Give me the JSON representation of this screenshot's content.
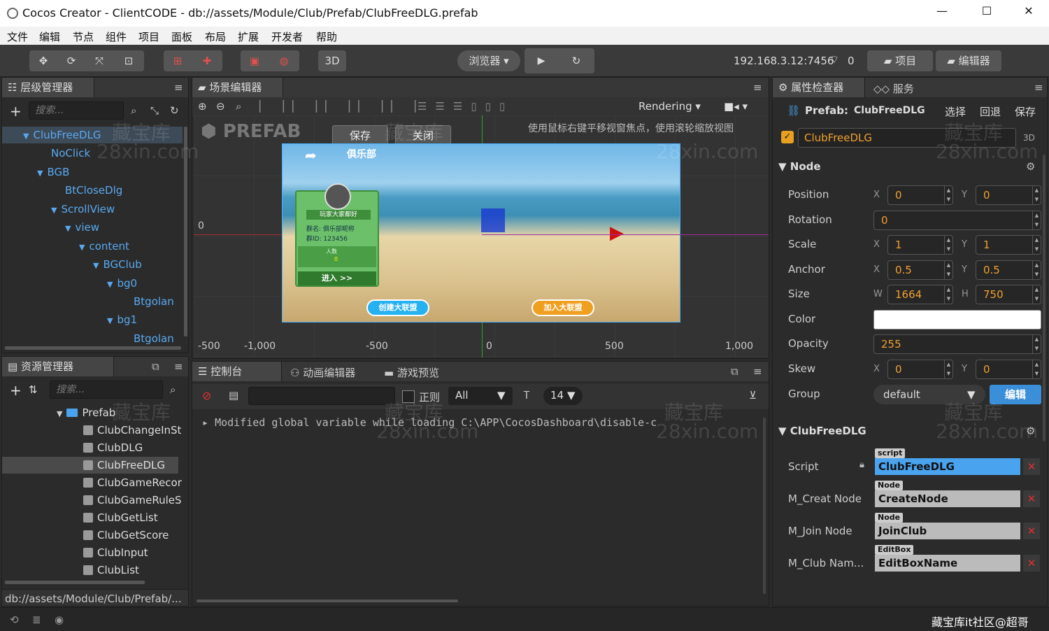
{
  "window": {
    "title": "Cocos Creator - ClientCODE - db://assets/Module/Club/Prefab/ClubFreeDLG.prefab",
    "minimize": "—",
    "maximize": "☐",
    "close": "✕"
  },
  "menu": [
    "文件",
    "编辑",
    "节点",
    "组件",
    "项目",
    "面板",
    "布局",
    "扩展",
    "开发者",
    "帮助"
  ],
  "toolbar": {
    "mode_3d": "3D",
    "browser": "浏览器 ▾",
    "ip": "192.168.3.12:7456",
    "conn_count": "0",
    "project": "项目",
    "editor": "编辑器"
  },
  "hierarchy": {
    "title": "层级管理器",
    "search_placeholder": "搜索...",
    "items": [
      "ClubFreeDLG",
      "NoClick",
      "BGB",
      "BtCloseDlg",
      "ScrollView",
      "view",
      "content",
      "BGClub",
      "bg0",
      "Btgolan",
      "bg1",
      "Btgolan"
    ]
  },
  "assets": {
    "title": "资源管理器",
    "search_placeholder": "搜索...",
    "folder": "Prefab",
    "items": [
      "ClubChangeInSt",
      "ClubDLG",
      "ClubFreeDLG",
      "ClubGameRecor",
      "ClubGameRuleS",
      "ClubGetList",
      "ClubGetScore",
      "ClubInput",
      "ClubList"
    ],
    "path": "db://assets/Module/Club/Prefab/..."
  },
  "scene": {
    "title": "场景编辑器",
    "rendering": "Rendering",
    "prefab_label": "PREFAB",
    "save": "保存",
    "close": "关闭",
    "hint": "使用鼠标右键平移视窗焦点，使用滚轮缩放视图",
    "axis_y0": "0",
    "axis_x": [
      "-500",
      "-1,000",
      "-500",
      "0",
      "500",
      "1,000"
    ],
    "game": {
      "title": "俱乐部",
      "card_title": "玩家大家都好",
      "card_line1": "群名: 俱乐部昵称",
      "card_line2": "群ID: 123456",
      "card_members": "人数",
      "card_count": "0",
      "enter": "进入 >>",
      "create": "创建大联盟",
      "join": "加入大联盟"
    }
  },
  "console": {
    "tabs": [
      "控制台",
      "动画编辑器",
      "游戏预览"
    ],
    "regex": "正则",
    "filter": "All",
    "font_size": "14",
    "log": "Modified global variable while loading C:\\APP\\CocosDashboard\\disable-c"
  },
  "inspector": {
    "tabs": [
      "属性检查器",
      "服务"
    ],
    "prefab_label": "Prefab:",
    "prefab_name": "ClubFreeDLG",
    "select": "选择",
    "revert": "回退",
    "save": "保存",
    "node_name": "ClubFreeDLG",
    "tag_3d": "3D",
    "node_section": "Node",
    "position": {
      "label": "Position",
      "x": "0",
      "y": "0"
    },
    "rotation": {
      "label": "Rotation",
      "v": "0"
    },
    "scale": {
      "label": "Scale",
      "x": "1",
      "y": "1"
    },
    "anchor": {
      "label": "Anchor",
      "x": "0.5",
      "y": "0.5"
    },
    "size": {
      "label": "Size",
      "w": "1664",
      "h": "750"
    },
    "color": {
      "label": "Color",
      "value": "#ffffff"
    },
    "opacity": {
      "label": "Opacity",
      "v": "255"
    },
    "skew": {
      "label": "Skew",
      "x": "0",
      "y": "0"
    },
    "group": {
      "label": "Group",
      "value": "default",
      "edit": "编辑"
    },
    "component": "ClubFreeDLG",
    "script": {
      "label": "Script",
      "tag": "script",
      "value": "ClubFreeDLG"
    },
    "creat_node": {
      "label": "M_Creat Node",
      "tag": "Node",
      "value": "CreateNode"
    },
    "join_node": {
      "label": "M_Join Node",
      "tag": "Node",
      "value": "JoinClub"
    },
    "club_name": {
      "label": "M_Club Nam...",
      "tag": "EditBox",
      "value": "EditBoxName"
    },
    "axes": {
      "x": "X",
      "y": "Y",
      "w": "W",
      "h": "H"
    }
  },
  "status": {
    "watermark": "藏宝库it社区@超哥"
  },
  "watermarks": {
    "cn": "藏宝库",
    "en": "28xin.com"
  }
}
